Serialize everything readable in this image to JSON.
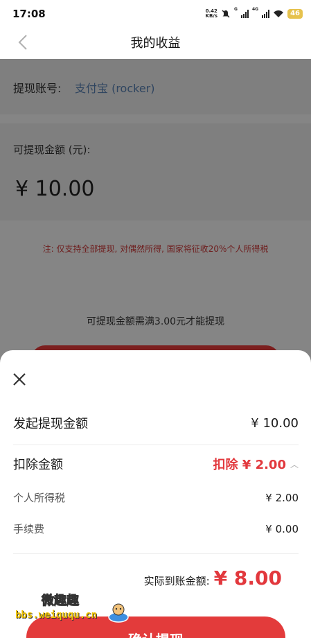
{
  "status_bar": {
    "time": "17:08",
    "net_speed_value": "0.42",
    "net_speed_unit": "KB/s",
    "signal1_label": "G",
    "signal2_label": "4G",
    "battery": "46"
  },
  "nav": {
    "title": "我的收益"
  },
  "account": {
    "label": "提现账号:",
    "value": "支付宝 (rocker)"
  },
  "balance": {
    "label": "可提现金额 (元):",
    "value": "¥ 10.00"
  },
  "notice": "注: 仅支持全部提现, 对偶然所得, 国家将征收20%个人所得税",
  "min_note": "可提现金额需满3.00元才能提现",
  "sheet": {
    "rows": [
      {
        "label": "发起提现金额",
        "value": "¥ 10.00"
      },
      {
        "label": "扣除金额",
        "value": "扣除 ¥ 2.00"
      },
      {
        "label": "个人所得税",
        "value": "¥ 2.00"
      },
      {
        "label": "手续费",
        "value": "¥ 0.00"
      }
    ],
    "actual_label": "实际到账金额:",
    "actual_value": "¥ 8.00",
    "confirm_label": "确认提现"
  },
  "watermark": {
    "top": "微趣趣",
    "bottom": "bbs.weiququ.cn"
  },
  "colors": {
    "accent": "#e2383d",
    "link": "#2f4560"
  }
}
